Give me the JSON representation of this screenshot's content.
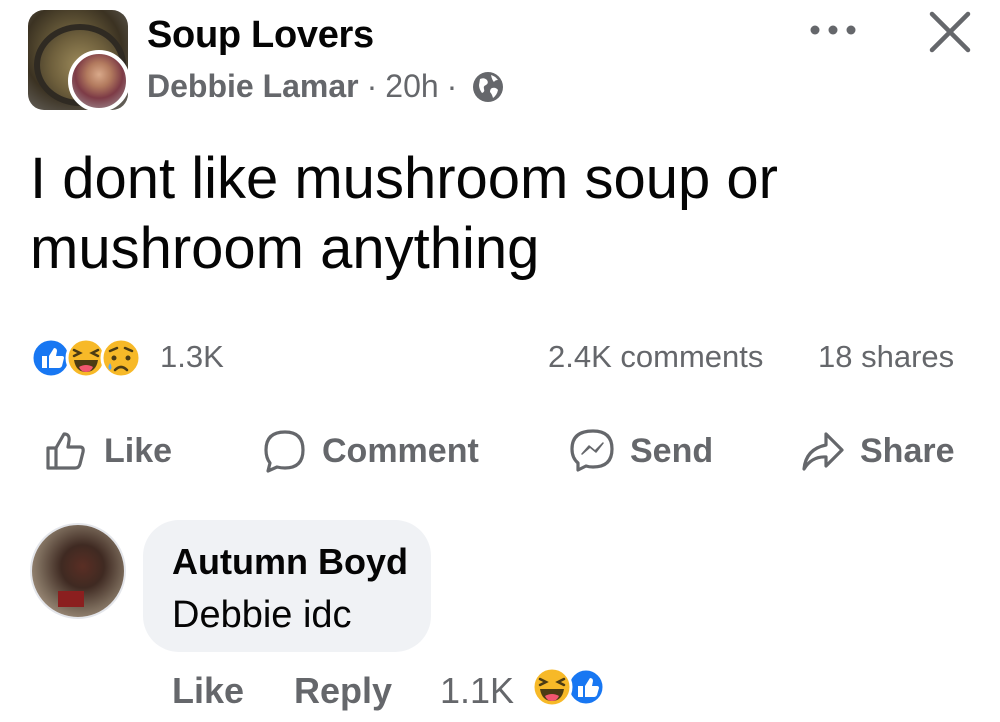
{
  "header": {
    "group_name": "Soup Lovers",
    "author": "Debbie Lamar",
    "separator": "·",
    "time": "20h",
    "audience_icon": "globe-icon"
  },
  "post": {
    "text": "I dont like mushroom soup or mushroom anything"
  },
  "stats": {
    "reaction_icons": [
      "like-icon",
      "haha-icon",
      "sad-icon"
    ],
    "reactions": "1.3K",
    "comments": "2.4K comments",
    "shares": "18 shares"
  },
  "actions": {
    "like": "Like",
    "comment": "Comment",
    "send": "Send",
    "share": "Share"
  },
  "comment": {
    "author": "Autumn Boyd",
    "text": "Debbie idc",
    "like_label": "Like",
    "reply_label": "Reply",
    "reaction_count": "1.1K",
    "reaction_icons": [
      "haha-icon",
      "like-icon"
    ]
  },
  "colors": {
    "like_blue": "#1877f2",
    "haha_yellow": "#f7b928",
    "secondary_text": "#65676b",
    "bubble_bg": "#f0f2f5"
  }
}
